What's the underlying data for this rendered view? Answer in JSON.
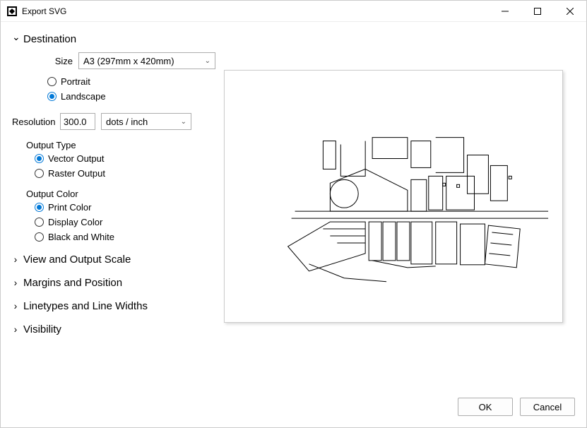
{
  "window": {
    "title": "Export SVG"
  },
  "sections": {
    "destination": {
      "title": "Destination",
      "expanded": true
    },
    "viewScale": {
      "title": "View and Output Scale"
    },
    "margins": {
      "title": "Margins and Position"
    },
    "linetypes": {
      "title": "Linetypes and Line Widths"
    },
    "visibility": {
      "title": "Visibility"
    }
  },
  "size": {
    "label": "Size",
    "value": "A3 (297mm x 420mm)",
    "orientation": {
      "portrait": "Portrait",
      "landscape": "Landscape",
      "selected": "landscape"
    }
  },
  "resolution": {
    "label": "Resolution",
    "value": "300.0",
    "unit": "dots / inch"
  },
  "outputType": {
    "label": "Output Type",
    "vector": "Vector Output",
    "raster": "Raster Output",
    "selected": "vector"
  },
  "outputColor": {
    "label": "Output Color",
    "print": "Print Color",
    "display": "Display Color",
    "bw": "Black and White",
    "selected": "print"
  },
  "buttons": {
    "ok": "OK",
    "cancel": "Cancel"
  }
}
